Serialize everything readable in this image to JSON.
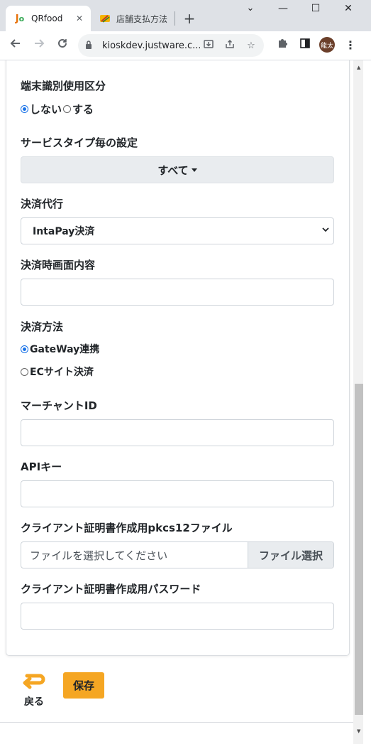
{
  "browser": {
    "tabs": [
      {
        "title": "QRfood",
        "favicon": "qrfood-logo-icon",
        "close": "✕"
      },
      {
        "title": "店舗支払方法",
        "favicon": "store-favicon-icon",
        "close": ""
      }
    ],
    "new_tab": "+",
    "window_controls": {
      "minimize": "—",
      "maximize": "☐",
      "close": "✕",
      "dropdown": "⌄"
    },
    "url": "kioskdev.justware.c...",
    "profile_initials": "龍太"
  },
  "form": {
    "terminal_usage": {
      "label": "端末識別使用区分",
      "options": [
        {
          "label": "しない",
          "selected": true
        },
        {
          "label": "する",
          "selected": false
        }
      ]
    },
    "service_type": {
      "label": "サービスタイプ毎の設定",
      "button": "すべて"
    },
    "payment_agent": {
      "label": "決済代行",
      "value": "IntaPay決済"
    },
    "payment_screen": {
      "label": "決済時画面内容",
      "value": ""
    },
    "payment_method": {
      "label": "決済方法",
      "options": [
        {
          "label": "GateWay連携",
          "selected": true
        },
        {
          "label": "ECサイト決済",
          "selected": false
        }
      ]
    },
    "merchant_id": {
      "label": "マーチャントID",
      "value": ""
    },
    "api_key": {
      "label": "APIキー",
      "value": ""
    },
    "client_cert_file": {
      "label": "クライアント証明書作成用pkcs12ファイル",
      "placeholder": "ファイルを選択してください",
      "button": "ファイル選択"
    },
    "client_cert_password": {
      "label": "クライアント証明書作成用パスワード",
      "value": ""
    }
  },
  "actions": {
    "back": "戻る",
    "save": "保存"
  },
  "colors": {
    "save_button": "#f5a623",
    "back_icon": "#f5a623",
    "radio_selected": "#1a73e8"
  }
}
